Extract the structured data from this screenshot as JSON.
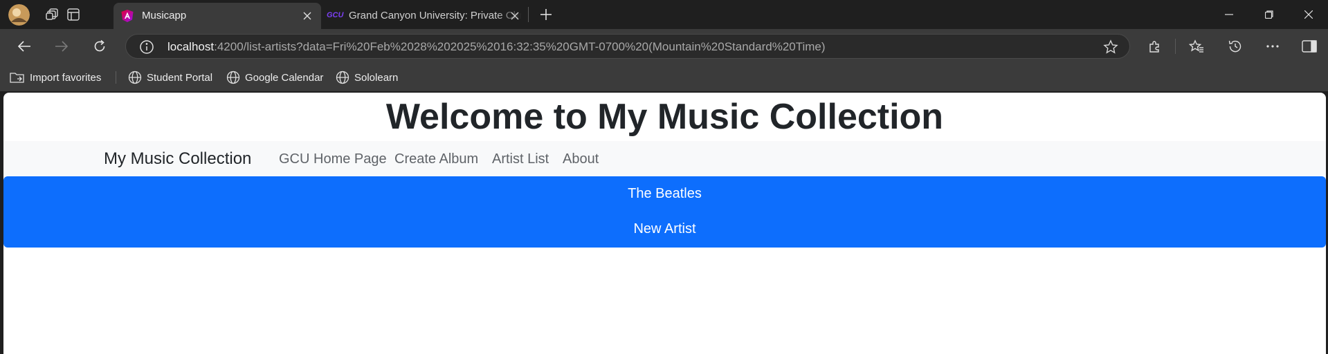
{
  "browser": {
    "tabs": [
      {
        "title": "Musicapp",
        "active": true
      },
      {
        "title": "Grand Canyon University: Private Chri",
        "active": false
      }
    ],
    "url": {
      "host": "localhost",
      "path": ":4200/list-artists?data=Fri%20Feb%2028%202025%2016:32:35%20GMT-0700%20(Mountain%20Standard%20Time)"
    },
    "favorites": [
      "Import favorites",
      "Student Portal",
      "Google Calendar",
      "Sololearn"
    ],
    "colors": {
      "tab_active": "#3b3b3b",
      "chrome_dark": "#1f1f1f"
    }
  },
  "page": {
    "heading": "Welcome to My Music Collection",
    "navbar": {
      "brand": "My Music Collection",
      "links": [
        "GCU Home Page",
        "Create Album",
        "Artist List",
        "About"
      ]
    },
    "artists": [
      "The Beatles",
      "New Artist"
    ],
    "colors": {
      "primary": "#0d6efd",
      "navbar_bg": "#f8f9fa",
      "text": "#212529"
    }
  }
}
